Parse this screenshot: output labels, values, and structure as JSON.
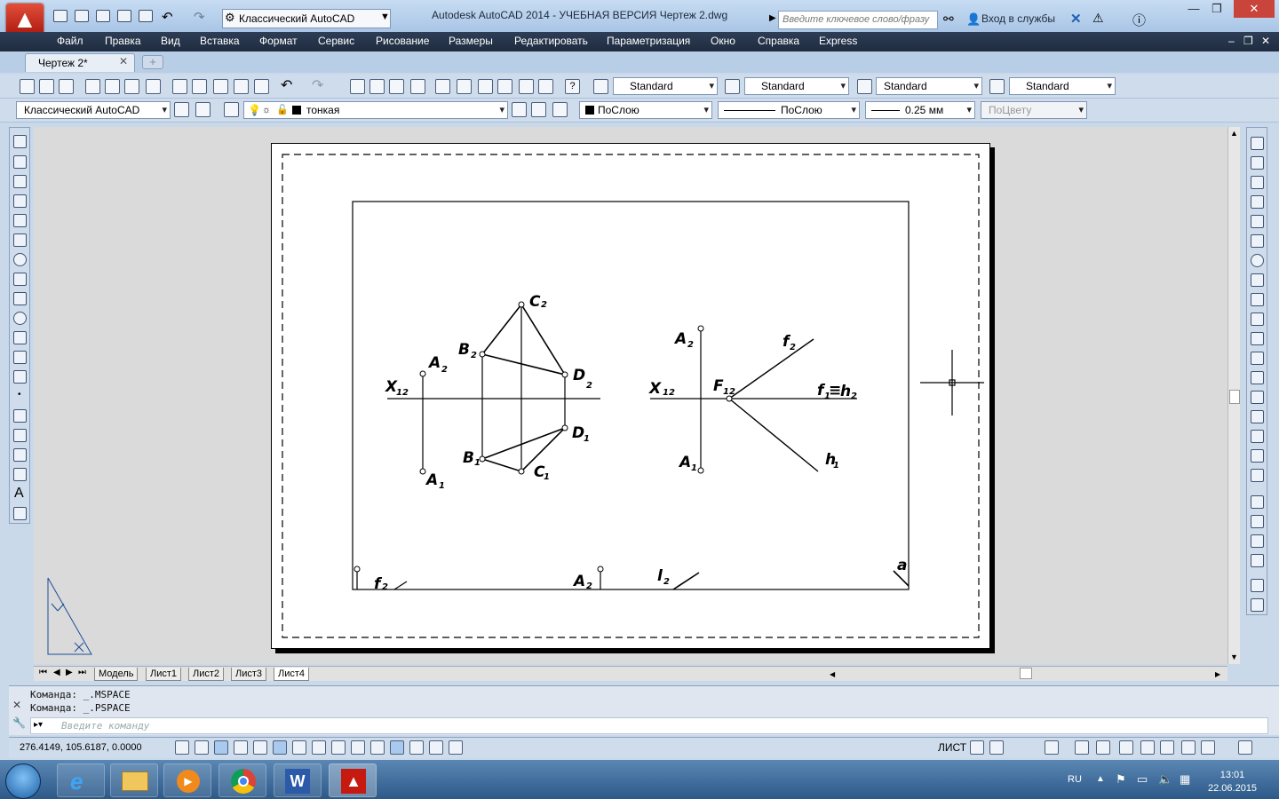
{
  "title_bar": {
    "workspace": "Классический AutoCAD",
    "app_title": "Autodesk AutoCAD 2014 - УЧЕБНАЯ ВЕРСИЯ     Чертеж 2.dwg",
    "search_placeholder": "Введите ключевое слово/фразу",
    "login": "Вход в службы"
  },
  "menu": [
    "Файл",
    "Правка",
    "Вид",
    "Вставка",
    "Формат",
    "Сервис",
    "Рисование",
    "Размеры",
    "Редактировать",
    "Параметризация",
    "Окно",
    "Справка",
    "Express"
  ],
  "document_tab": "Чертеж 2*",
  "styles": {
    "text": "Standard",
    "dim": "Standard",
    "table": "Standard",
    "mleader": "Standard"
  },
  "layers_row": {
    "workspace": "Классический AutoCAD",
    "layer": "тонкая",
    "color": "ПоСлою",
    "linetype": "ПоСлою",
    "lineweight": "0.25 мм",
    "plotstyle": "ПоЦвету"
  },
  "layout_tabs": [
    "Модель",
    "Лист1",
    "Лист2",
    "Лист3",
    "Лист4"
  ],
  "command_history": [
    "Команда:  _.MSPACE",
    "Команда:  _.PSPACE"
  ],
  "command_placeholder": "Введите команду",
  "status": {
    "coords": "276.4149, 105.6187, 0.0000",
    "space": "ЛИСТ"
  },
  "taskbar": {
    "lang": "RU",
    "time": "13:01",
    "date": "22.06.2015"
  },
  "drawing_labels": {
    "c2": "C",
    "c2s": "2",
    "b2": "B",
    "b2s": "2",
    "a2": "A",
    "a2s": "2",
    "d2": "D",
    "d2s": "2",
    "x12": "X",
    "x12s": "12",
    "d1": "D",
    "d1s": "1",
    "b1": "B",
    "b1s": "1",
    "c1": "C",
    "c1s": "1",
    "a1": "A",
    "a1s": "1",
    "ra2": "A",
    "ra2s": "2",
    "f2": "f",
    "f2s": "2",
    "rx": "X",
    "rxs": "12",
    "F12": "F",
    "F12s": "12",
    "f1h2a": "f",
    "f1h2b": "1",
    "f1h2c": "≡",
    "f1h2d": "h",
    "f1h2e": "2",
    "ra1": "A",
    "ra1s": "1",
    "h1": "h",
    "h1s": "1",
    "bf": "f",
    "bfs": "2",
    "ba": "A",
    "bas": "2",
    "bl": "l",
    "bls": "2",
    "ba2": "a"
  }
}
